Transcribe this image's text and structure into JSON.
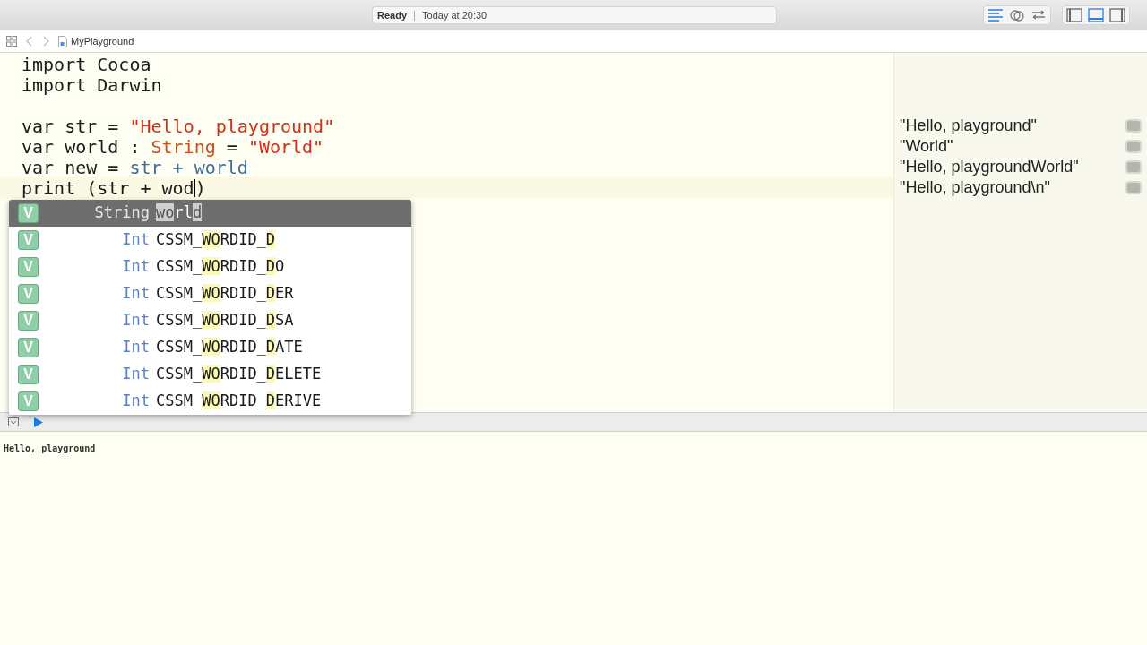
{
  "toolbar": {
    "status": "Ready",
    "time": "Today at 20:30",
    "editor_modes": [
      {
        "selected": true
      },
      {
        "selected": false
      },
      {
        "selected": false
      }
    ],
    "panels": [
      {
        "selected": false
      },
      {
        "selected": true
      },
      {
        "selected": false
      }
    ]
  },
  "jump_bar": {
    "file": "MyPlayground"
  },
  "code_lines": [
    {
      "kind": "code",
      "tokens": [
        {
          "kind": "plain",
          "text": "import Cocoa",
          "caret_after": false
        }
      ]
    },
    {
      "kind": "code",
      "tokens": [
        {
          "kind": "plain",
          "text": "import Darwin",
          "caret_after": false
        }
      ]
    },
    {
      "kind": "blank"
    },
    {
      "kind": "code",
      "tokens": [
        {
          "kind": "plain",
          "text": "var str = ",
          "caret_after": false
        },
        {
          "kind": "string",
          "text": "\"Hello, playground\"",
          "caret_after": false
        }
      ]
    },
    {
      "kind": "code",
      "tokens": [
        {
          "kind": "plain",
          "text": "var world : ",
          "caret_after": false
        },
        {
          "kind": "type",
          "text": "String",
          "caret_after": false
        },
        {
          "kind": "plain",
          "text": " = ",
          "caret_after": false
        },
        {
          "kind": "string",
          "text": "\"World\"",
          "caret_after": false
        }
      ]
    },
    {
      "kind": "code",
      "tokens": [
        {
          "kind": "plain",
          "text": "var new = ",
          "caret_after": false
        },
        {
          "kind": "ident",
          "text": "str + world",
          "caret_after": false
        }
      ]
    },
    {
      "kind": "current",
      "tokens": [
        {
          "kind": "plain",
          "text": "print (str + wod",
          "caret_after": true
        },
        {
          "kind": "plain",
          "text": ")",
          "caret_after": false
        }
      ]
    }
  ],
  "results": [
    {
      "text": "\"Hello, playground\""
    },
    {
      "text": "\"World\""
    },
    {
      "text": "\"Hello, playgroundWorld\""
    },
    {
      "text": "\"Hello, playground\\n\""
    }
  ],
  "completions": [
    {
      "badge": "V",
      "type": "String",
      "selected": true,
      "name": [
        {
          "text": "wo",
          "match": true
        },
        {
          "text": "rl",
          "match": false
        },
        {
          "text": "d",
          "match": true
        }
      ]
    },
    {
      "badge": "V",
      "type": "Int",
      "selected": false,
      "name": [
        {
          "text": "CSSM_",
          "match": false
        },
        {
          "text": "WO",
          "match": true
        },
        {
          "text": "RDID_",
          "match": false
        },
        {
          "text": "D",
          "match": true
        }
      ]
    },
    {
      "badge": "V",
      "type": "Int",
      "selected": false,
      "name": [
        {
          "text": "CSSM_",
          "match": false
        },
        {
          "text": "WO",
          "match": true
        },
        {
          "text": "RDID_",
          "match": false
        },
        {
          "text": "D",
          "match": true
        },
        {
          "text": "O",
          "match": false
        }
      ]
    },
    {
      "badge": "V",
      "type": "Int",
      "selected": false,
      "name": [
        {
          "text": "CSSM_",
          "match": false
        },
        {
          "text": "WO",
          "match": true
        },
        {
          "text": "RDID_",
          "match": false
        },
        {
          "text": "D",
          "match": true
        },
        {
          "text": "ER",
          "match": false
        }
      ]
    },
    {
      "badge": "V",
      "type": "Int",
      "selected": false,
      "name": [
        {
          "text": "CSSM_",
          "match": false
        },
        {
          "text": "WO",
          "match": true
        },
        {
          "text": "RDID_",
          "match": false
        },
        {
          "text": "D",
          "match": true
        },
        {
          "text": "SA",
          "match": false
        }
      ]
    },
    {
      "badge": "V",
      "type": "Int",
      "selected": false,
      "name": [
        {
          "text": "CSSM_",
          "match": false
        },
        {
          "text": "WO",
          "match": true
        },
        {
          "text": "RDID_",
          "match": false
        },
        {
          "text": "D",
          "match": true
        },
        {
          "text": "ATE",
          "match": false
        }
      ]
    },
    {
      "badge": "V",
      "type": "Int",
      "selected": false,
      "name": [
        {
          "text": "CSSM_",
          "match": false
        },
        {
          "text": "WO",
          "match": true
        },
        {
          "text": "RDID_",
          "match": false
        },
        {
          "text": "D",
          "match": true
        },
        {
          "text": "ELETE",
          "match": false
        }
      ]
    },
    {
      "badge": "V",
      "type": "Int",
      "selected": false,
      "name": [
        {
          "text": "CSSM_",
          "match": false
        },
        {
          "text": "WO",
          "match": true
        },
        {
          "text": "RDID_",
          "match": false
        },
        {
          "text": "D",
          "match": true
        },
        {
          "text": "ERIVE",
          "match": false
        }
      ]
    }
  ],
  "console": {
    "output": "Hello, playground"
  }
}
